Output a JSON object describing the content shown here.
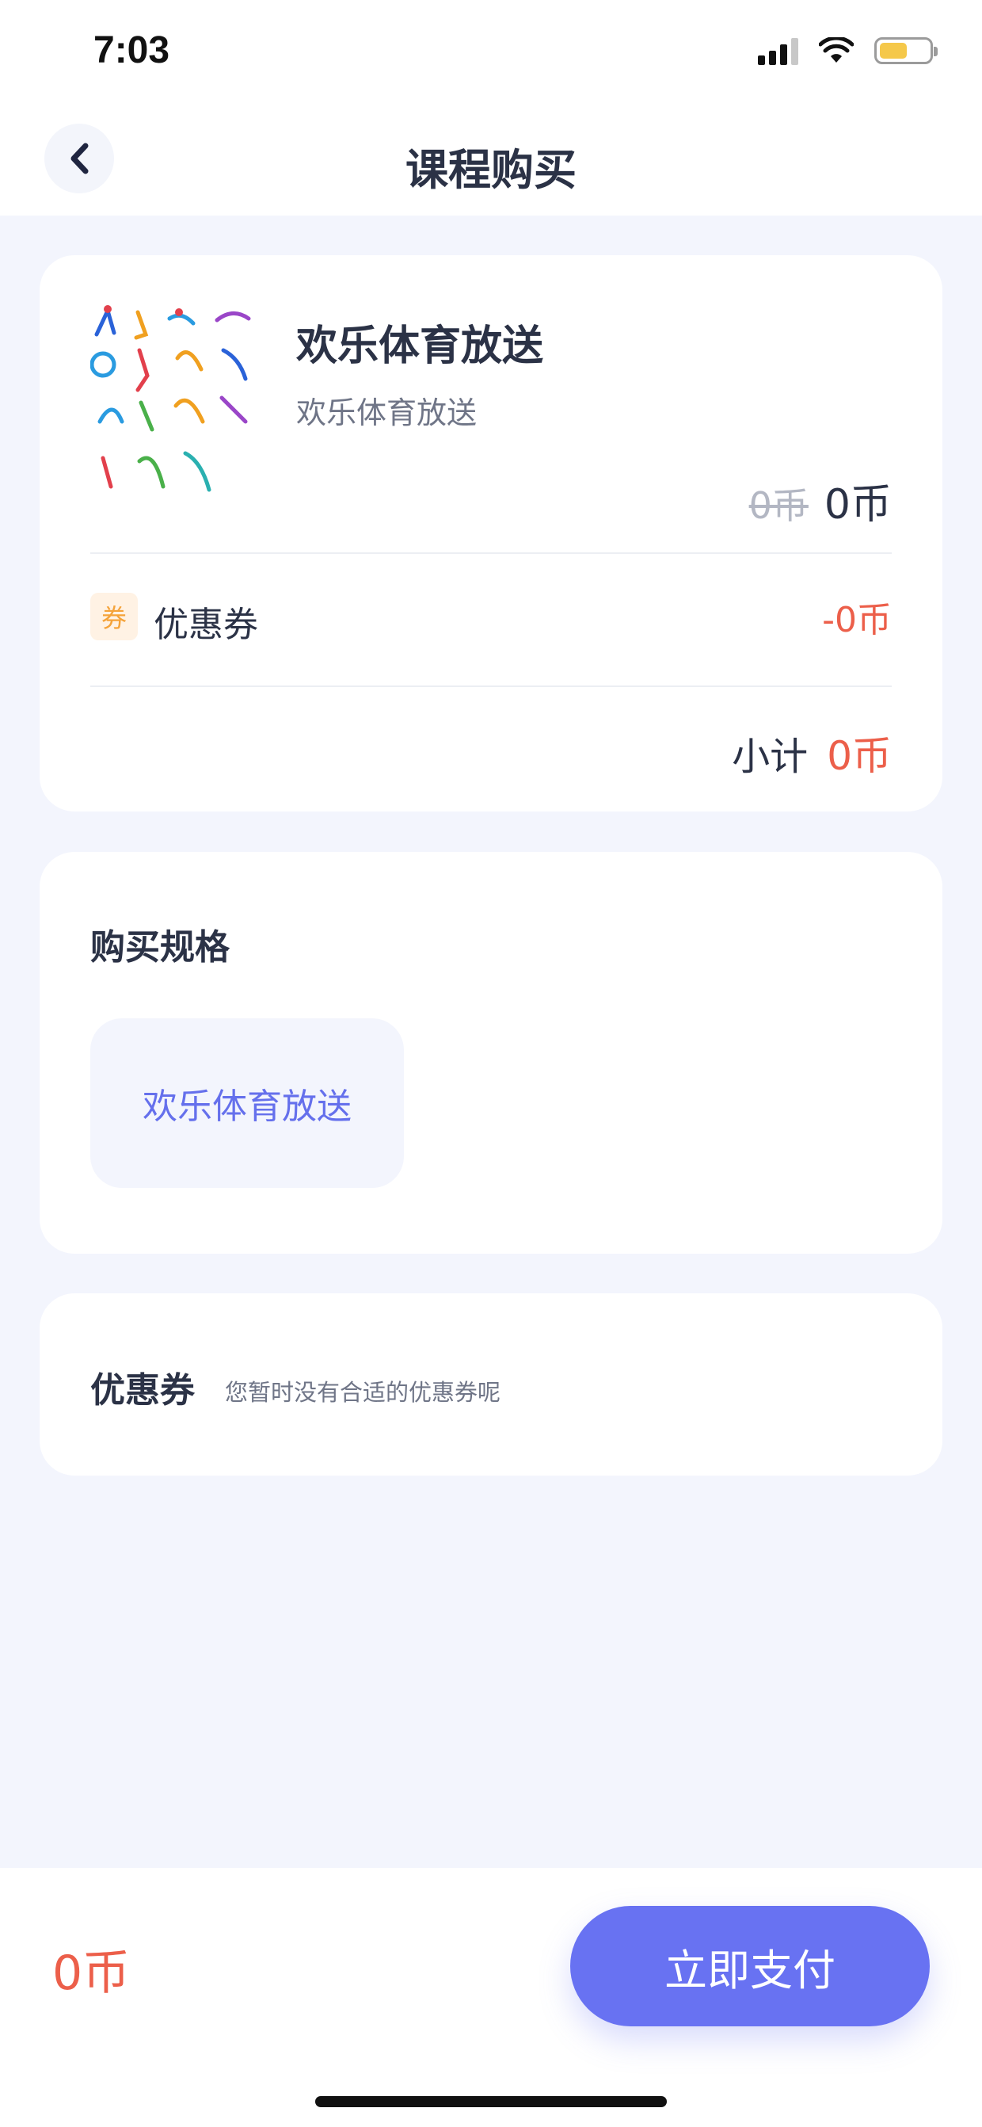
{
  "status": {
    "time": "7:03"
  },
  "nav": {
    "title": "课程购买"
  },
  "course": {
    "name": "欢乐体育放送",
    "subtitle": "欢乐体育放送",
    "original_price": "0币",
    "price": "0币"
  },
  "coupon_row": {
    "badge": "券",
    "label": "优惠券",
    "value": "-0币"
  },
  "subtotal": {
    "label": "小计",
    "value": "0币"
  },
  "spec": {
    "title": "购买规格",
    "option": "欢乐体育放送"
  },
  "coupon_section": {
    "title": "优惠券",
    "note": "您暂时没有合适的优惠券呢"
  },
  "footer": {
    "total": "0币",
    "pay_label": "立即支付"
  },
  "colors": {
    "accent": "#6872f2",
    "price_red": "#ec5f4a",
    "coupon_orange": "#f5a33a"
  }
}
